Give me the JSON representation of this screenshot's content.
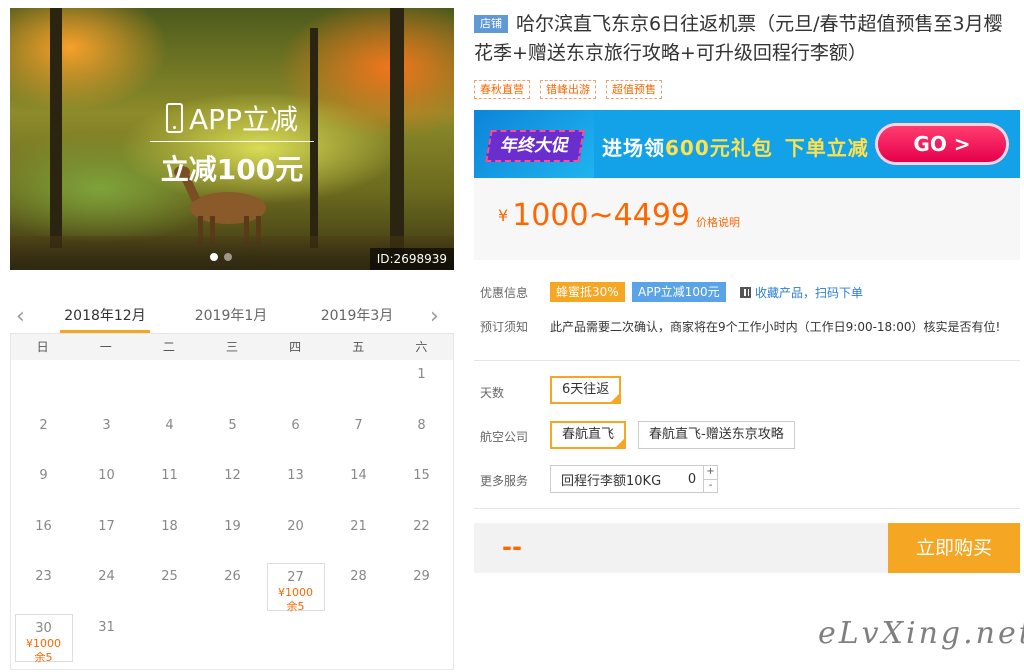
{
  "hero": {
    "promo_title": "APP立减",
    "promo_sub": "立减100元",
    "id_badge": "ID:2698939"
  },
  "calendar": {
    "months": [
      "2018年12月",
      "2019年1月",
      "2019年3月"
    ],
    "active_month": 0,
    "weekdays": [
      "日",
      "一",
      "二",
      "三",
      "四",
      "五",
      "六"
    ],
    "days": [
      {
        "d": "1",
        "col": 6,
        "row": 0
      },
      {
        "d": "2",
        "col": 0,
        "row": 1
      },
      {
        "d": "3",
        "col": 1,
        "row": 1
      },
      {
        "d": "4",
        "col": 2,
        "row": 1
      },
      {
        "d": "5",
        "col": 3,
        "row": 1
      },
      {
        "d": "6",
        "col": 4,
        "row": 1
      },
      {
        "d": "7",
        "col": 5,
        "row": 1
      },
      {
        "d": "8",
        "col": 6,
        "row": 1
      },
      {
        "d": "9",
        "col": 0,
        "row": 2
      },
      {
        "d": "10",
        "col": 1,
        "row": 2
      },
      {
        "d": "11",
        "col": 2,
        "row": 2
      },
      {
        "d": "12",
        "col": 3,
        "row": 2
      },
      {
        "d": "13",
        "col": 4,
        "row": 2
      },
      {
        "d": "14",
        "col": 5,
        "row": 2
      },
      {
        "d": "15",
        "col": 6,
        "row": 2
      },
      {
        "d": "16",
        "col": 0,
        "row": 3
      },
      {
        "d": "17",
        "col": 1,
        "row": 3
      },
      {
        "d": "18",
        "col": 2,
        "row": 3
      },
      {
        "d": "19",
        "col": 3,
        "row": 3
      },
      {
        "d": "20",
        "col": 4,
        "row": 3
      },
      {
        "d": "21",
        "col": 5,
        "row": 3
      },
      {
        "d": "22",
        "col": 6,
        "row": 3
      },
      {
        "d": "23",
        "col": 0,
        "row": 4
      },
      {
        "d": "24",
        "col": 1,
        "row": 4
      },
      {
        "d": "25",
        "col": 2,
        "row": 4
      },
      {
        "d": "26",
        "col": 3,
        "row": 4
      },
      {
        "d": "27",
        "col": 4,
        "row": 4,
        "price": "¥1000",
        "left": "余5"
      },
      {
        "d": "28",
        "col": 5,
        "row": 4
      },
      {
        "d": "29",
        "col": 6,
        "row": 4
      },
      {
        "d": "30",
        "col": 0,
        "row": 5,
        "price": "¥1000",
        "left": "余5"
      },
      {
        "d": "31",
        "col": 1,
        "row": 5
      }
    ]
  },
  "product": {
    "shop_badge": "店铺",
    "title": "哈尔滨直飞东京6日往返机票（元旦/春节超值预售至3月樱花季+赠送东京旅行攻略+可升级回程行李额）",
    "tags": [
      "春秋直营",
      "错峰出游",
      "超值预售"
    ]
  },
  "banner": {
    "badge": "年终大促",
    "text_pre": "进场领",
    "text_hl": "600元礼包",
    "text_act": "下单立减",
    "go": "GO >"
  },
  "price": {
    "currency": "¥",
    "range": "1000~4499",
    "note": "价格说明"
  },
  "info": {
    "discount_label": "优惠信息",
    "chip1": "蜂蜜抵30%",
    "chip2": "APP立减100元",
    "fav": "收藏产品，扫码下单",
    "notice_label": "预订须知",
    "notice": "此产品需要二次确认，商家将在9个工作小时内（工作日9:00-18:00）核实是否有位!"
  },
  "options": {
    "days_label": "天数",
    "days_value": "6天往返",
    "airline_label": "航空公司",
    "airline_1": "春航直飞",
    "airline_2": "春航直飞-赠送东京攻略",
    "service_label": "更多服务",
    "service_name": "回程行李额10KG",
    "service_qty": "0",
    "plus": "+",
    "minus": "-"
  },
  "buy": {
    "total": "--",
    "button": "立即购买"
  },
  "watermark": "eLvXing.net",
  "colors": {
    "accent": "#f5a623",
    "price": "#ff6600",
    "link": "#2a7ed3",
    "chip_orange": "#f5a623",
    "chip_blue": "#5aa3e6"
  }
}
